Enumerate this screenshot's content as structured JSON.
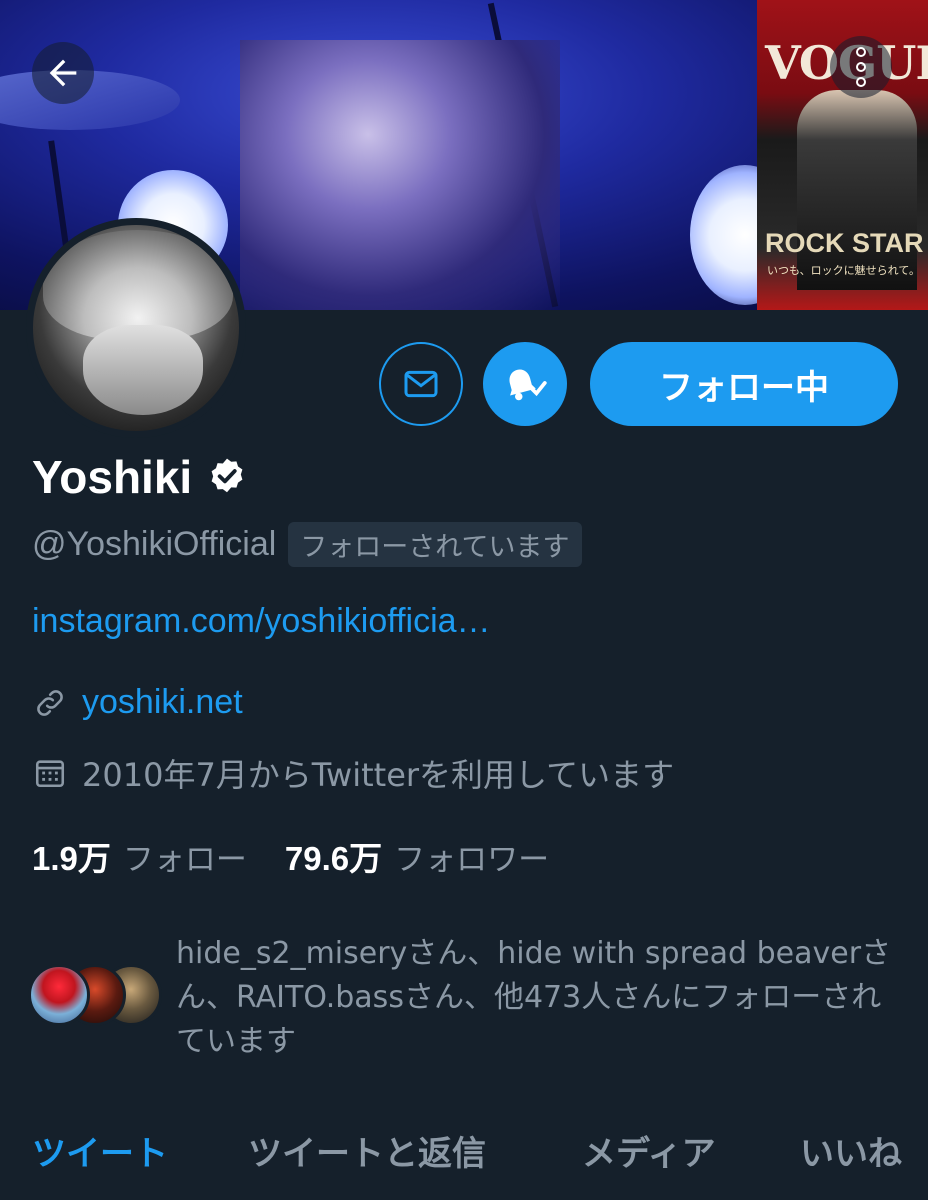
{
  "header": {
    "magazine_title": "VOGUE",
    "magazine_cover_text": "ROCK STAR",
    "magazine_sub": "いつも、ロックに魅せられて。"
  },
  "actions": {
    "follow_label": "フォロー中"
  },
  "profile": {
    "name": "Yoshiki",
    "handle": "@YoshikiOfficial",
    "follows_you": "フォローされています",
    "bio_link": "instagram.com/yoshikiofficia…",
    "website": "yoshiki.net",
    "joined": "2010年7月からTwitterを利用しています"
  },
  "stats": {
    "following_count": "1.9万",
    "following_label": "フォロー",
    "followers_count": "79.6万",
    "followers_label": "フォロワー"
  },
  "mutuals": {
    "text": "hide_s2_miseryさん、hide with spread beaverさん、RAITO.bassさん、他473人さんにフォローされています"
  },
  "tabs": [
    {
      "label": "ツイート"
    },
    {
      "label": "ツイートと返信"
    },
    {
      "label": "メディア"
    },
    {
      "label": "いいね"
    }
  ],
  "colors": {
    "background": "#15202b",
    "accent": "#1d9bf0",
    "secondary_text": "#8b98a5"
  }
}
